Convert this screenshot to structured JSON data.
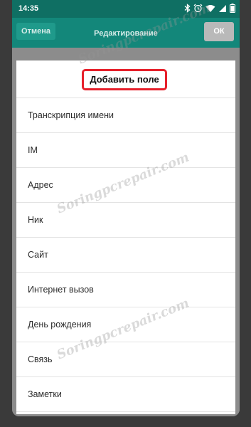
{
  "status_bar": {
    "time": "14:35",
    "icons": [
      "bluetooth-icon",
      "alarm-icon",
      "wifi-icon",
      "signal-icon",
      "battery-icon"
    ]
  },
  "action_bar": {
    "cancel_label": "Отмена",
    "title": "Редактирование",
    "ok_label": "ОК"
  },
  "dialog": {
    "title": "Добавить поле",
    "items": [
      "Транскрипция имени",
      "IM",
      "Адрес",
      "Ник",
      "Сайт",
      "Интернет вызов",
      "День рождения",
      "Связь",
      "Заметки"
    ]
  },
  "watermark": "Soringpcrepair.com",
  "colors": {
    "status_bar": "#0f6f63",
    "action_bar": "#13877a",
    "highlight_border": "#e6202b"
  }
}
